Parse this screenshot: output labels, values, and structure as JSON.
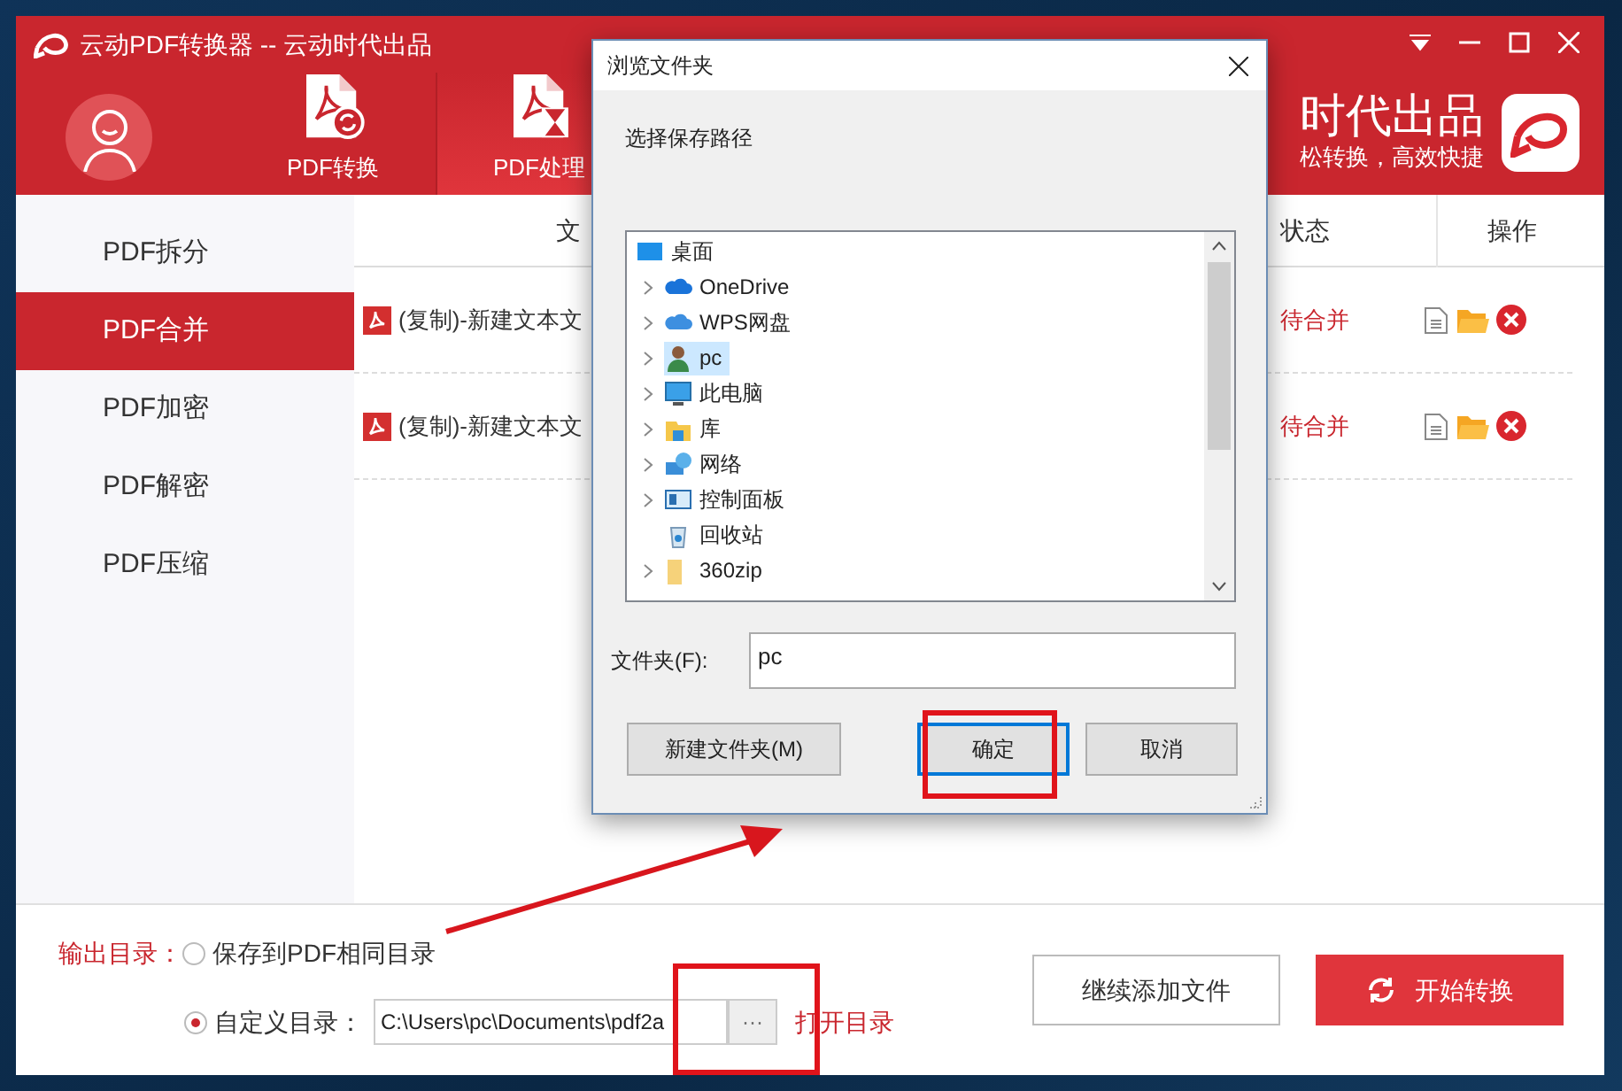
{
  "window": {
    "title": "云动PDF转换器 -- 云动时代出品"
  },
  "tabs": [
    {
      "label": "PDF转换",
      "selected": false
    },
    {
      "label": "PDF处理",
      "selected": true
    }
  ],
  "brand": {
    "title": "时代出品",
    "slogan": "松转换，高效快捷"
  },
  "sidebar": {
    "items": [
      {
        "label": "PDF拆分",
        "selected": false
      },
      {
        "label": "PDF合并",
        "selected": true
      },
      {
        "label": "PDF加密",
        "selected": false
      },
      {
        "label": "PDF解密",
        "selected": false
      },
      {
        "label": "PDF压缩",
        "selected": false
      }
    ]
  },
  "table": {
    "columns": [
      "文",
      "状态",
      "操作"
    ],
    "rows": [
      {
        "file": "(复制)-新建文本文",
        "status": "待合并"
      },
      {
        "file": "(复制)-新建文本文",
        "status": "待合并"
      }
    ]
  },
  "output": {
    "label": "输出目录：",
    "options": [
      {
        "label": "保存到PDF相同目录",
        "selected": false
      },
      {
        "label": "自定义目录：",
        "selected": true
      }
    ],
    "path": "C:\\Users\\pc\\Documents\\pdf2a",
    "browse": "···",
    "open_link": "打开目录"
  },
  "buttons": [
    {
      "label": "继续添加文件",
      "kind": "secondary"
    },
    {
      "label": "开始转换",
      "kind": "primary"
    }
  ],
  "dialog": {
    "title": "浏览文件夹",
    "prompt": "选择保存路径",
    "tree": [
      {
        "label": "桌面",
        "expandable": false,
        "selected": false,
        "children": [
          {
            "label": "OneDrive",
            "expandable": true,
            "selected": false
          },
          {
            "label": "WPS网盘",
            "expandable": true,
            "selected": false
          },
          {
            "label": "pc",
            "expandable": true,
            "selected": true
          },
          {
            "label": "此电脑",
            "expandable": true,
            "selected": false
          },
          {
            "label": "库",
            "expandable": true,
            "selected": false
          },
          {
            "label": "网络",
            "expandable": true,
            "selected": false
          },
          {
            "label": "控制面板",
            "expandable": true,
            "selected": false
          },
          {
            "label": "回收站",
            "expandable": false,
            "selected": false
          },
          {
            "label": "360zip",
            "expandable": true,
            "selected": false
          }
        ]
      }
    ],
    "folder_label": "文件夹(F):",
    "folder_value": "pc",
    "buttons": [
      {
        "label": "新建文件夹(M)",
        "focused": false
      },
      {
        "label": "确定",
        "focused": true
      },
      {
        "label": "取消",
        "focused": false
      }
    ]
  }
}
